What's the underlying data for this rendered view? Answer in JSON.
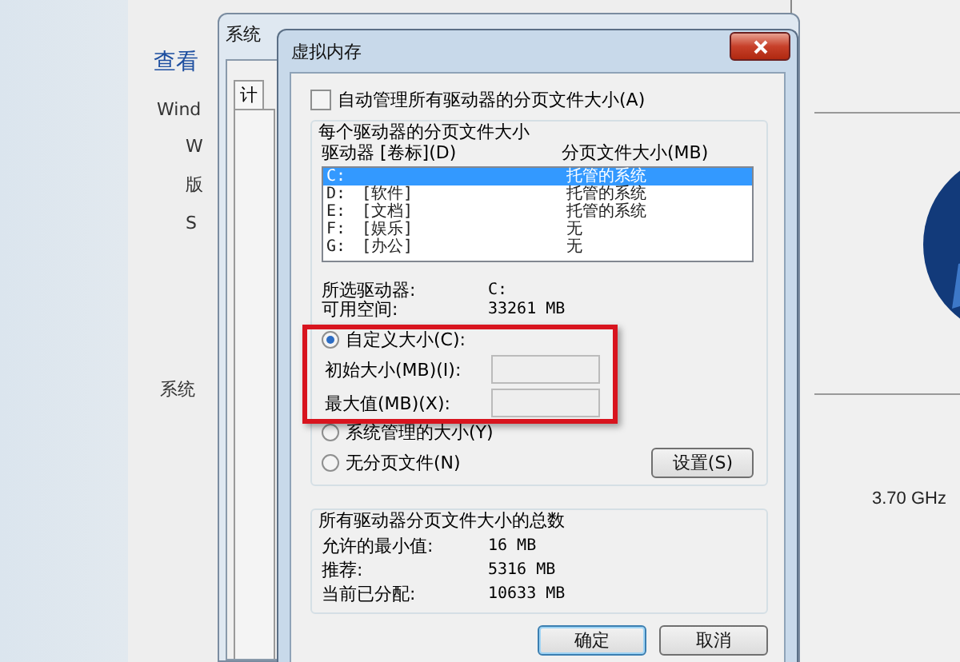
{
  "background_window": {
    "heading": "查看",
    "texts": [
      "Wind",
      "W",
      "版",
      "S"
    ],
    "section": "系统",
    "processor_speed": "3.70 GHz"
  },
  "system_properties": {
    "title": "系统",
    "tab": "计"
  },
  "dialog": {
    "title": "虚拟内存",
    "auto_manage": {
      "label": "自动管理所有驱动器的分页文件大小(A)",
      "checked": false
    },
    "per_drive_group": "每个驱动器的分页文件大小",
    "columns": [
      "驱动器 [卷标](D)",
      "分页文件大小(MB)"
    ],
    "drives": [
      {
        "drive": "C:",
        "size": "托管的系统",
        "selected": true
      },
      {
        "drive": "D:",
        "label": "[软件]",
        "size": "托管的系统",
        "selected": false
      },
      {
        "drive": "E:",
        "label": "[文档]",
        "size": "托管的系统",
        "selected": false
      },
      {
        "drive": "F:",
        "label": "[娱乐]",
        "size": "无",
        "selected": false
      },
      {
        "drive": "G:",
        "label": "[办公]",
        "size": "无",
        "selected": false
      }
    ],
    "selected_drive": {
      "label": "所选驱动器:",
      "value": "C:"
    },
    "free_space": {
      "label": "可用空间:",
      "value": "33261 MB"
    },
    "size_options": [
      {
        "kind": "radio",
        "label": "自定义大小(C):",
        "selected": true
      },
      {
        "kind": "field",
        "label": "初始大小(MB)(I):"
      },
      {
        "kind": "field",
        "label": "最大值(MB)(X):"
      },
      {
        "kind": "radio",
        "label": "系统管理的大小(Y)",
        "selected": false
      },
      {
        "kind": "radio",
        "label": "无分页文件(N)",
        "selected": false
      }
    ],
    "set_button": "设置(S)",
    "totals_group": "所有驱动器分页文件大小的总数",
    "totals": [
      {
        "label": "允许的最小值:",
        "value": "16 MB"
      },
      {
        "label": "推荐:",
        "value": "5316 MB"
      },
      {
        "label": "当前已分配:",
        "value": "10633 MB"
      }
    ],
    "buttons": [
      {
        "label": "确定",
        "default": true
      },
      {
        "label": "取消",
        "default": false
      }
    ]
  },
  "annotation": {
    "highlight_box": true
  }
}
